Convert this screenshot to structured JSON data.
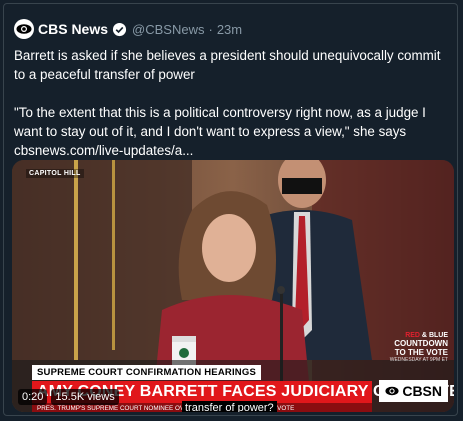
{
  "tweet": {
    "author_name": "CBS News",
    "handle": "@CBSNews",
    "separator": "·",
    "time": "23m",
    "text_line1": "Barrett is asked if she believes a president should unequivocally commit to a peaceful transfer of power",
    "text_quote": "\"To the extent that this is a political controversy right now, as a judge I want to stay out of it, and I don't want to express a view,\" she says",
    "link": "cbsnews.com/live-updates/a..."
  },
  "video": {
    "location_tag": "CAPITOL HILL",
    "red_blue_red": "RED",
    "red_blue_amp": " & ",
    "red_blue_blue": "BLUE",
    "countdown_line1": "COUNTDOWN",
    "countdown_line2": "TO THE VOTE",
    "countdown_sub": "WEDNESDAY AT 9PM ET",
    "lower_third_top": "SUPREME COURT CONFIRMATION HEARINGS",
    "lower_third_main": "AMY CONEY BARRETT FACES JUDICIARY COMMITTEE",
    "lower_third_sub": "PRES. TRUMP'S SUPREME COURT NOMINEE OVER SEVERAL DAYS AHEAD OF VOTE",
    "network_logo": "CBSN",
    "timestamp": "0:20",
    "views": "15.5K views",
    "caption": "transfer of power?"
  },
  "colors": {
    "background": "#15202b",
    "secondary_text": "#8899a6",
    "verified": "#1da1f2",
    "lower_third_red": "#e1171b"
  }
}
